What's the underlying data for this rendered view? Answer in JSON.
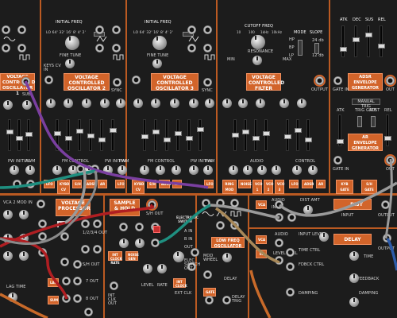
{
  "top": {
    "initial_freq_1": "INITIAL FREQ",
    "initial_freq_2": "INITIAL FREQ",
    "range_row": "LO 64' 32' 16' 8' 4' 2'",
    "fine_tune_1": "FINE TUNE",
    "fine_tune_2": "FINE TUNE",
    "keys_cv_in": "KEYS CV IN",
    "sub": "SUB",
    "sync_1": "SYNC",
    "sync_2": "SYNC",
    "pw_initial": "PW INITIAL",
    "pwm": "PWM",
    "fm_control": "FM CONTROL",
    "control": "CONTROL",
    "audio": "AUDIO",
    "output": "OUTPUT",
    "cutoff_freq": "CUTOFF FREQ",
    "cutoff_scale": [
      "10",
      "100",
      "1kHz",
      "10kHz"
    ],
    "resonance": "RESONANCE",
    "min": "MIN",
    "max": "MAX",
    "mode": "MODE",
    "slope": "SLOPE",
    "mode_opts": [
      "HP",
      "BP",
      "LP"
    ],
    "slope_opts": [
      "24 db",
      "12 db"
    ],
    "adsr_params": [
      "ATK",
      "DEC",
      "SUS",
      "REL"
    ],
    "gate_in": "GATE IN",
    "out": "OUT",
    "manual_trig": "MANUAL TRIG",
    "ar_atk": "ATK",
    "ar_rel": "REL",
    "trig_gate": "TRIG GATE",
    "sust": "SUST",
    "keyb_gate": "KYB GATE",
    "sh_gate": "S/H GATE"
  },
  "modules": {
    "vco1": "VOLTAGE CONTROLLED OSCILLATOR 1",
    "vco2": "VOLTAGE CONTROLLED OSCILLATOR 2",
    "vco3": "VOLTAGE CONTROLLED OSCILLATOR 3",
    "vcf": "VOLTAGE CONTROLLED FILTER",
    "adsr": "ADSR ENVELOPE GENERATOR",
    "ar": "AR ENVELOPE GENERATOR",
    "vp": "VOLTAGE PROCESSOR",
    "sh": "SAMPLE & HOLD",
    "lfo": "LOW FREQ OSCILLATOR",
    "dist": "DIST",
    "delay": "DELAY"
  },
  "mod_labels": {
    "lfo": "LFO",
    "kybd_cv": "KYBD CV",
    "sh": "S/H",
    "adsr": "ADSR",
    "ar": "AR",
    "noise": "NOISE",
    "ring_mod": "RING MOD",
    "vco1": "VCO 1",
    "vco2": "VCO 2",
    "vco3": "VCO 3",
    "ring": "RING"
  },
  "lower": {
    "vca2_mod_in": "VCA 2 MOD IN",
    "lag_time": "LAG TIME",
    "vp_out": "1/2/3/4 OUT",
    "sh_out_l": "S/H OUT",
    "seven_out": "7 OUT",
    "eight_out": "8 OUT",
    "lag": "LAG",
    "sum": "SUM",
    "int_clock_rate": "INT CLOCK RATE",
    "noise_gen": "NOISE GEN",
    "sh_out": "S/H OUT",
    "electronic_switch": "ELECTRONIC SWITCH",
    "int_clk_out": "INT CLK OUT",
    "level": "LEVEL",
    "rate": "RATE",
    "int_clock": "INT CLOCK",
    "a_in": "A IN",
    "b_in": "B IN",
    "out": "OUT",
    "ext_clk": "EXT CLK",
    "elec_switch_out": "ELEC SWITCH OUT",
    "mod_wheel": "MOD WHEEL",
    "delay": "DELAY",
    "gate": "GATE",
    "delay_trig": "DELAY TRIG",
    "vca": "VCA",
    "audio": "AUDIO",
    "in": "IN",
    "dist_amt": "DIST AMT",
    "input": "INPUT",
    "output": "OUTPUT",
    "input_level": "INPUT LEVEL",
    "time_ctrl": "TIME CTRL",
    "fdbck_ctrl": "FDBCK CTRL",
    "time": "TIME",
    "feedback": "FEEDBACK",
    "damping": "DAMPING",
    "level_ctrl": "LEVEL CTRL"
  },
  "colors": {
    "panel": "#1c1c1c",
    "accent": "#d2642a",
    "cable_purple": "#7a3fa0",
    "cable_red": "#b01e22",
    "cable_teal": "#1f8f80",
    "cable_grey": "#9a9a9a",
    "cable_tan": "#a88858",
    "cable_blue": "#2c5aa8",
    "cable_orange": "#c86a2a"
  }
}
